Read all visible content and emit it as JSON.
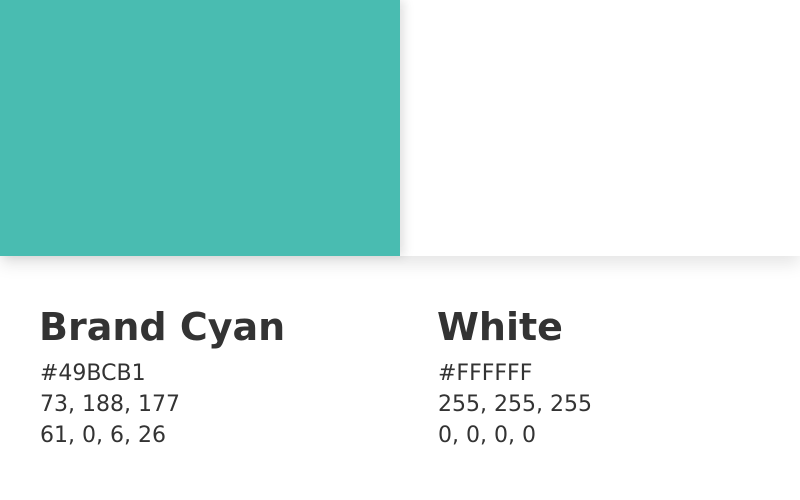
{
  "colors": [
    {
      "name": "Brand Cyan",
      "hex": "#49BCB1",
      "rgb": "73, 188, 177",
      "cmyk": "61, 0, 6, 26",
      "swatch_color": "#49BCB1"
    },
    {
      "name": "White",
      "hex": "#FFFFFF",
      "rgb": "255, 255, 255",
      "cmyk": "0, 0, 0, 0",
      "swatch_color": "#FFFFFF"
    }
  ]
}
